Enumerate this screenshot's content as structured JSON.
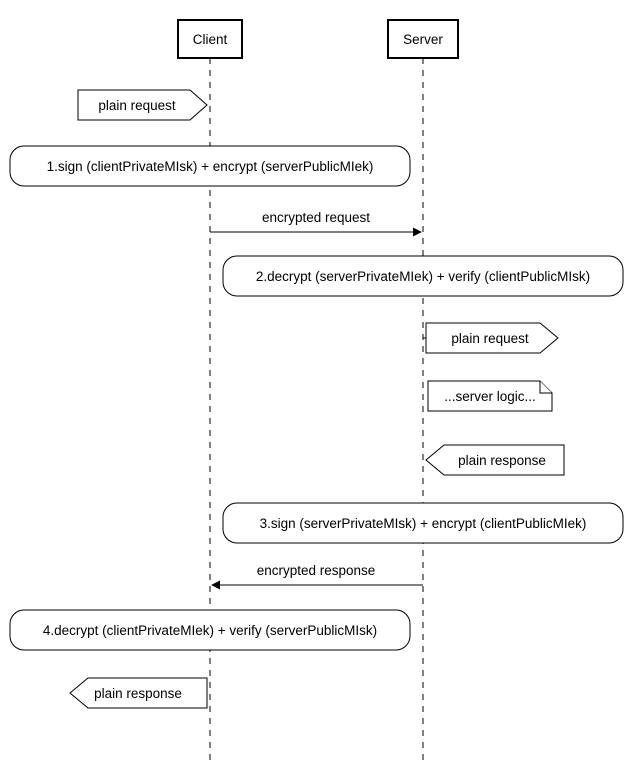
{
  "participants": {
    "client": "Client",
    "server": "Server"
  },
  "items": {
    "plain_request_out": "plain request",
    "step1": "1.sign (clientPrivateMIsk) + encrypt (serverPublicMIek)",
    "msg_encrypted_req": "encrypted request",
    "step2": "2.decrypt (serverPrivateMIek) + verify (clientPublicMIsk)",
    "plain_request_in": "plain request",
    "server_logic": "...server logic...",
    "plain_response_out": "plain response",
    "step3": "3.sign (serverPrivateMIsk) + encrypt (clientPublicMIek)",
    "msg_encrypted_resp": "encrypted response",
    "step4": "4.decrypt (clientPrivateMIek) + verify (serverPublicMIsk)",
    "plain_response_in": "plain response"
  }
}
